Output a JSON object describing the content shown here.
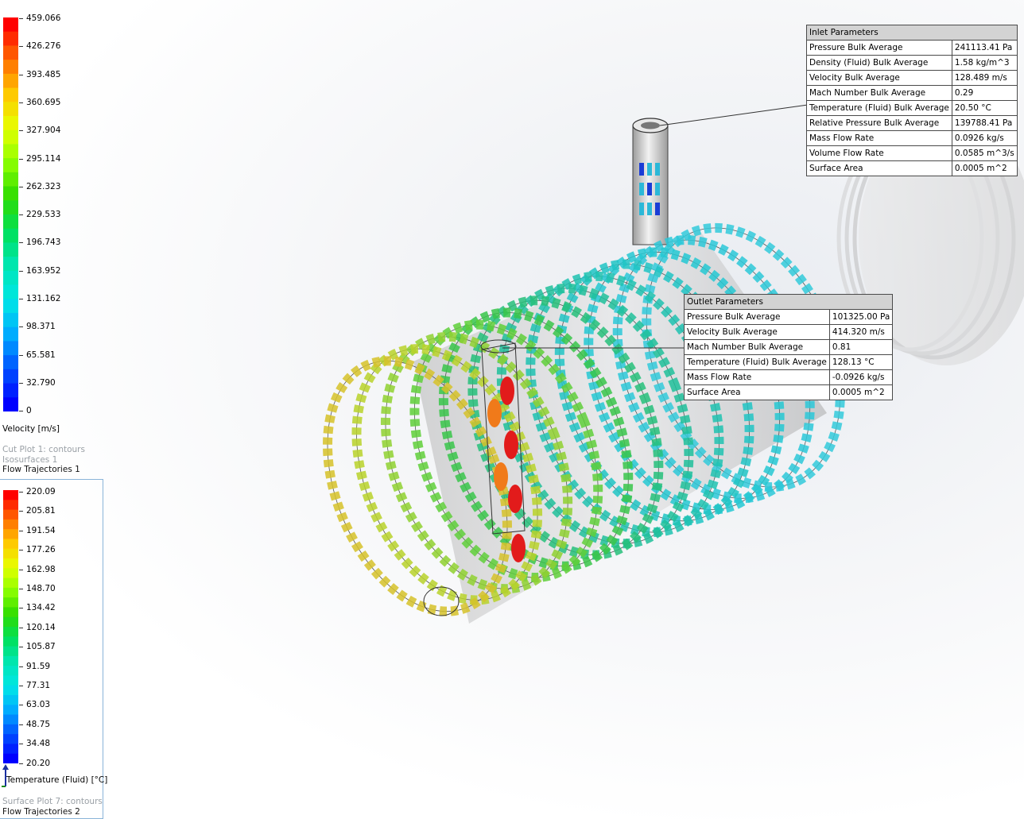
{
  "velocity_legend": {
    "title": "Velocity [m/s]",
    "ticks": [
      "459.066",
      "426.276",
      "393.485",
      "360.695",
      "327.904",
      "295.114",
      "262.323",
      "229.533",
      "196.743",
      "163.952",
      "131.162",
      "98.371",
      "65.581",
      "32.790",
      "0"
    ],
    "gradient": [
      "#ff0000",
      "#ff6a00",
      "#ffc800",
      "#e6ff00",
      "#8cff00",
      "#2fdc00",
      "#00e05a",
      "#00e6b4",
      "#00e6e6",
      "#00aaff",
      "#0050ff",
      "#0000ff"
    ]
  },
  "plot_labels": {
    "cut_plot": "Cut Plot 1: contours",
    "isosurfaces": "Isosurfaces 1",
    "flow_traj_1": "Flow Trajectories 1",
    "surface_plot": "Surface Plot 7: contours",
    "flow_traj_2": "Flow Trajectories 2"
  },
  "temperature_legend": {
    "title": "Temperature (Fluid) [°C]",
    "ticks": [
      "220.09",
      "205.81",
      "191.54",
      "177.26",
      "162.98",
      "148.70",
      "134.42",
      "120.14",
      "105.87",
      "91.59",
      "77.31",
      "63.03",
      "48.75",
      "34.48",
      "20.20"
    ]
  },
  "inlet": {
    "title": "Inlet Parameters",
    "rows": [
      {
        "name": "Pressure Bulk Average",
        "value": "241113.41 Pa"
      },
      {
        "name": "Density (Fluid) Bulk Average",
        "value": "1.58 kg/m^3"
      },
      {
        "name": "Velocity Bulk Average",
        "value": "128.489 m/s"
      },
      {
        "name": "Mach Number Bulk Average",
        "value": "0.29"
      },
      {
        "name": "Temperature (Fluid) Bulk Average",
        "value": "20.50 °C"
      },
      {
        "name": "Relative Pressure Bulk Average",
        "value": "139788.41 Pa"
      },
      {
        "name": "Mass Flow Rate",
        "value": "0.0926 kg/s"
      },
      {
        "name": "Volume Flow Rate",
        "value": "0.0585 m^3/s"
      },
      {
        "name": "Surface Area",
        "value": "0.0005 m^2"
      }
    ]
  },
  "outlet": {
    "title": "Outlet Parameters",
    "rows": [
      {
        "name": "Pressure Bulk Average",
        "value": "101325.00 Pa"
      },
      {
        "name": "Velocity Bulk Average",
        "value": "414.320 m/s"
      },
      {
        "name": "Mach Number Bulk Average",
        "value": "0.81"
      },
      {
        "name": "Temperature (Fluid) Bulk Average",
        "value": "128.13 °C"
      },
      {
        "name": "Mass Flow Rate",
        "value": "-0.0926 kg/s"
      },
      {
        "name": "Surface Area",
        "value": "0.0005 m^2"
      }
    ]
  }
}
